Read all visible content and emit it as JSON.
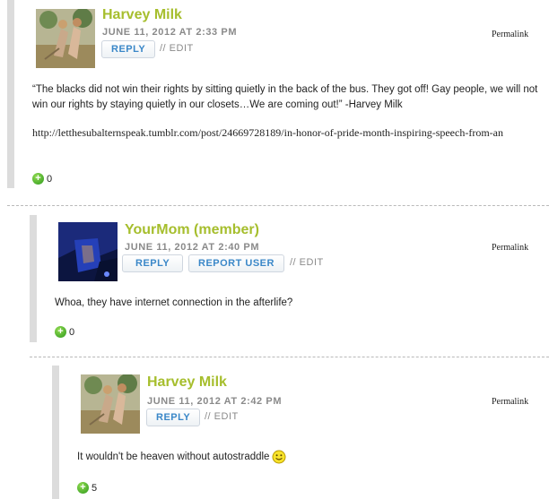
{
  "comments": [
    {
      "author": "Harvey Milk",
      "date": "JUNE 11, 2012 AT 2:33 PM",
      "reply_label": "REPLY",
      "edit_label": "// EDIT",
      "permalink_label": "Permalink",
      "text": "“The blacks did not win their rights by sitting quietly in the back of the bus. They got off! Gay people, we will not win our rights by staying quietly in our closets…We are coming out!” -Harvey Milk",
      "url": "http://letthesubalternspeak.tumblr.com/post/24669728189/in-honor-of-pride-month-inspiring-speech-from-an",
      "votes": "0"
    },
    {
      "author": "YourMom (member)",
      "date": "JUNE 11, 2012 AT 2:40 PM",
      "reply_label": "REPLY",
      "report_label": "REPORT USER",
      "edit_label": "// EDIT",
      "permalink_label": "Permalink",
      "text": "Whoa, they have internet connection in the afterlife?",
      "votes": "0"
    },
    {
      "author": "Harvey Milk",
      "date": "JUNE 11, 2012 AT 2:42 PM",
      "reply_label": "REPLY",
      "edit_label": "// EDIT",
      "permalink_label": "Permalink",
      "text": "It wouldn't be heaven without autostraddle",
      "votes": "5"
    }
  ],
  "colors": {
    "author": "#a6be2d",
    "button_text": "#3a87c8",
    "bar": "#dcdcdc",
    "vote_icon": "#3aa424"
  },
  "icons": [
    "plus-vote-icon",
    "smiley-icon"
  ]
}
